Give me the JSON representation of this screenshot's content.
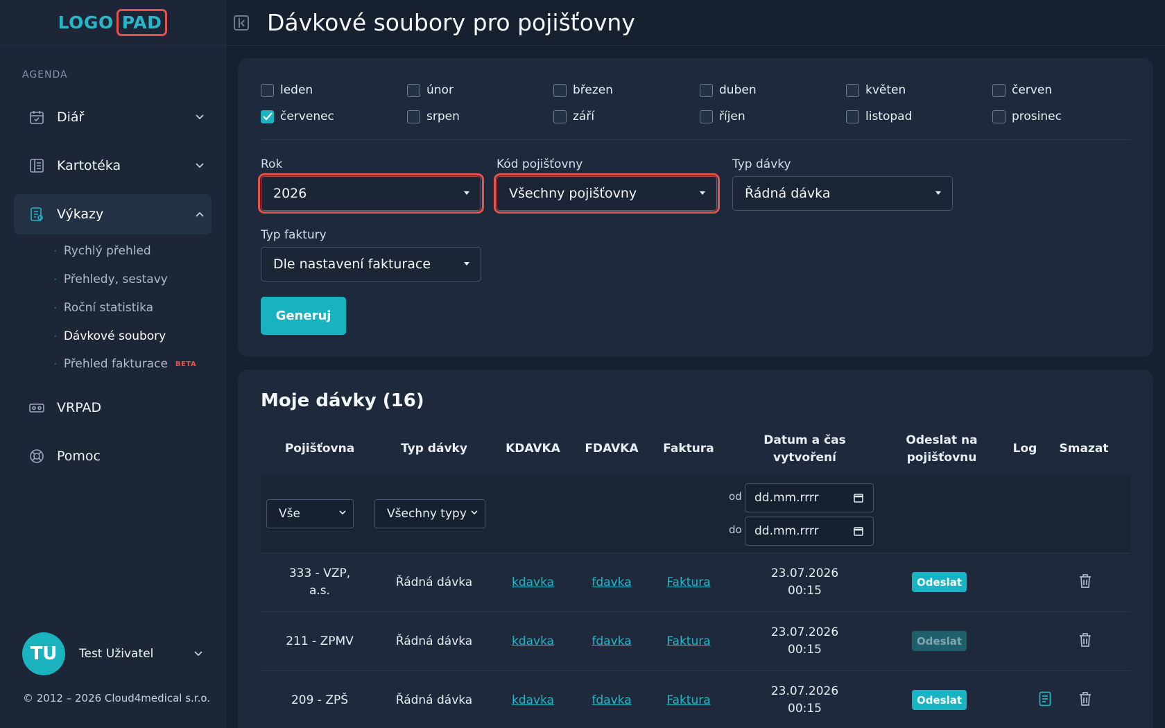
{
  "app": {
    "logo_left": "LOGO",
    "logo_right": "PAD",
    "page_title": "Dávkové soubory pro pojišťovny"
  },
  "sidebar": {
    "section": "AGENDA",
    "items": [
      {
        "label": "Diář",
        "icon": "calendar-icon"
      },
      {
        "label": "Kartotéka",
        "icon": "book-icon"
      },
      {
        "label": "Výkazy",
        "icon": "report-icon"
      },
      {
        "label": "VRPAD",
        "icon": "vr-headset-icon"
      },
      {
        "label": "Pomoc",
        "icon": "lifebuoy-icon"
      }
    ],
    "sub_items": [
      {
        "label": "Rychlý přehled"
      },
      {
        "label": "Přehledy, sestavy"
      },
      {
        "label": "Roční statistika"
      },
      {
        "label": "Dávkové soubory"
      },
      {
        "label": "Přehled fakturace",
        "badge": "BETA"
      }
    ],
    "user": {
      "initials": "TU",
      "name": "Test Uživatel"
    },
    "copyright": "© 2012 – 2026 Cloud4medical s.r.o."
  },
  "filters": {
    "months": [
      {
        "label": "leden",
        "checked": false
      },
      {
        "label": "únor",
        "checked": false
      },
      {
        "label": "březen",
        "checked": false
      },
      {
        "label": "duben",
        "checked": false
      },
      {
        "label": "květen",
        "checked": false
      },
      {
        "label": "červen",
        "checked": false
      },
      {
        "label": "červenec",
        "checked": true
      },
      {
        "label": "srpen",
        "checked": false
      },
      {
        "label": "září",
        "checked": false
      },
      {
        "label": "říjen",
        "checked": false
      },
      {
        "label": "listopad",
        "checked": false
      },
      {
        "label": "prosinec",
        "checked": false
      }
    ],
    "year_label": "Rok",
    "year_value": "2026",
    "insurer_label": "Kód pojišťovny",
    "insurer_value": "Všechny pojišťovny",
    "batch_type_label": "Typ dávky",
    "batch_type_value": "Řádná dávka",
    "invoice_type_label": "Typ faktury",
    "invoice_type_value": "Dle nastavení fakturace",
    "generate_label": "Generuj"
  },
  "batches": {
    "title": "Moje dávky (16)",
    "columns": {
      "insurer": "Pojišťovna",
      "type": "Typ dávky",
      "kdavka": "KDAVKA",
      "fdavka": "FDAVKA",
      "invoice": "Faktura",
      "created_1": "Datum a čas",
      "created_2": "vytvoření",
      "send_1": "Odeslat na",
      "send_2": "pojišťovnu",
      "log": "Log",
      "delete": "Smazat"
    },
    "filter_insurer": "Vše",
    "filter_type": "Všechny typy",
    "date_from_label": "od",
    "date_to_label": "do",
    "date_placeholder": "dd.mm.rrrr",
    "rows": [
      {
        "insurer_1": "333 - VZP,",
        "insurer_2": "a.s.",
        "type": "Řádná dávka",
        "kdavka": "kdavka",
        "fdavka": "fdavka",
        "invoice": "Faktura",
        "date": "23.07.2026",
        "time": "00:15",
        "send": "Odeslat",
        "send_enabled": true,
        "has_log": false
      },
      {
        "insurer_1": "211 - ZPMV",
        "insurer_2": "",
        "type": "Řádná dávka",
        "kdavka": "kdavka",
        "fdavka": "fdavka",
        "invoice": "Faktura",
        "date": "23.07.2026",
        "time": "00:15",
        "send": "Odeslat",
        "send_enabled": false,
        "has_log": false
      },
      {
        "insurer_1": "209 - ZPŠ",
        "insurer_2": "",
        "type": "Řádná dávka",
        "kdavka": "kdavka",
        "fdavka": "fdavka",
        "invoice": "Faktura",
        "date": "23.07.2026",
        "time": "00:15",
        "send": "Odeslat",
        "send_enabled": true,
        "has_log": true
      }
    ]
  },
  "colors": {
    "accent": "#1ab3bf",
    "highlight": "#e5544c",
    "background": "#17202e"
  }
}
